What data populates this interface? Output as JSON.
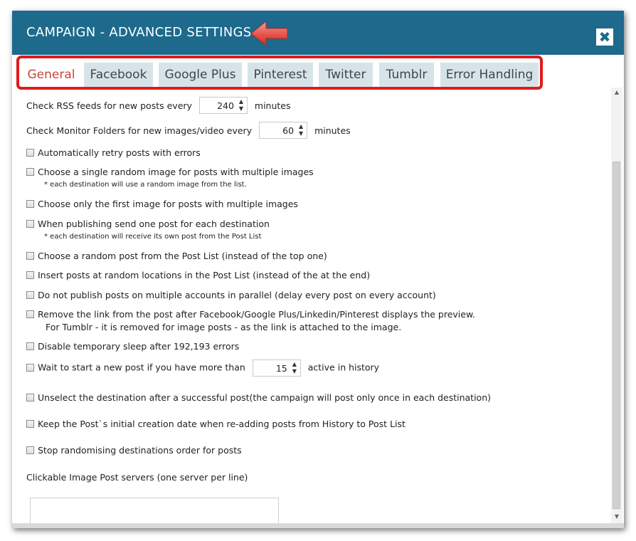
{
  "window": {
    "title": "CAMPAIGN - ADVANCED SETTINGS",
    "close_label": "✖"
  },
  "tabs": [
    {
      "label": "General",
      "active": true
    },
    {
      "label": "Facebook",
      "active": false
    },
    {
      "label": "Google Plus",
      "active": false
    },
    {
      "label": "Pinterest",
      "active": false
    },
    {
      "label": "Twitter",
      "active": false
    },
    {
      "label": "Tumblr",
      "active": false
    },
    {
      "label": "Error Handling",
      "active": false
    }
  ],
  "settings": {
    "rss": {
      "before": "Check RSS feeds for new posts every",
      "value": "240",
      "after": "minutes"
    },
    "monitor": {
      "before": "Check Monitor Folders for new images/video every",
      "value": "60",
      "after": "minutes"
    },
    "checkboxes": [
      {
        "label": "Automatically retry posts with errors",
        "checked": false
      },
      {
        "label": "Choose a single random image for posts with multiple images",
        "checked": false
      },
      {
        "label": "Choose only the first image for posts with multiple images",
        "checked": false
      },
      {
        "label": "When publishing send one post for each destination",
        "checked": false
      },
      {
        "label": "Choose a random post from the Post List (instead of the top one)",
        "checked": false
      },
      {
        "label": "Insert posts at random locations in the Post List (instead of the at the end)",
        "checked": false
      },
      {
        "label": "Do not publish posts on multiple accounts in parallel (delay every post on every account)",
        "checked": false
      },
      {
        "label": "Remove the link from the post after Facebook/Google Plus/Linkedin/Pinterest displays the preview.",
        "checked": false
      },
      {
        "label": "Disable temporary sleep after 192,193 errors",
        "checked": false
      },
      {
        "label": "Unselect the destination after a successful post(the campaign will post only once in each destination)",
        "checked": false
      },
      {
        "label": "Keep the Post`s initial creation date when re-adding posts from History to Post List",
        "checked": false
      },
      {
        "label": "Stop randomising destinations order for posts",
        "checked": false
      }
    ],
    "notes": {
      "random_image": "* each destination will use a random image from the list.",
      "one_post": "* each destination will receive its own post from the Post List",
      "tumblr": "For Tumblr - it is removed for image posts - as the link is attached to the image."
    },
    "wait": {
      "label": "Wait to start a new post if you have more than",
      "value": "15",
      "after": "active in history",
      "checked": false
    },
    "servers_label": "Clickable Image Post servers (one server per line)",
    "servers_value": ""
  },
  "colors": {
    "titlebar": "#1d6a8c",
    "tab_bg": "#d6e4ea",
    "active_tab_text": "#c8453a",
    "highlight": "#e11a1a",
    "arrow": "#e8534b"
  },
  "icons": {
    "arrow": "left-arrow-icon",
    "close": "close-icon",
    "spin": "spinner-arrows-icon"
  }
}
